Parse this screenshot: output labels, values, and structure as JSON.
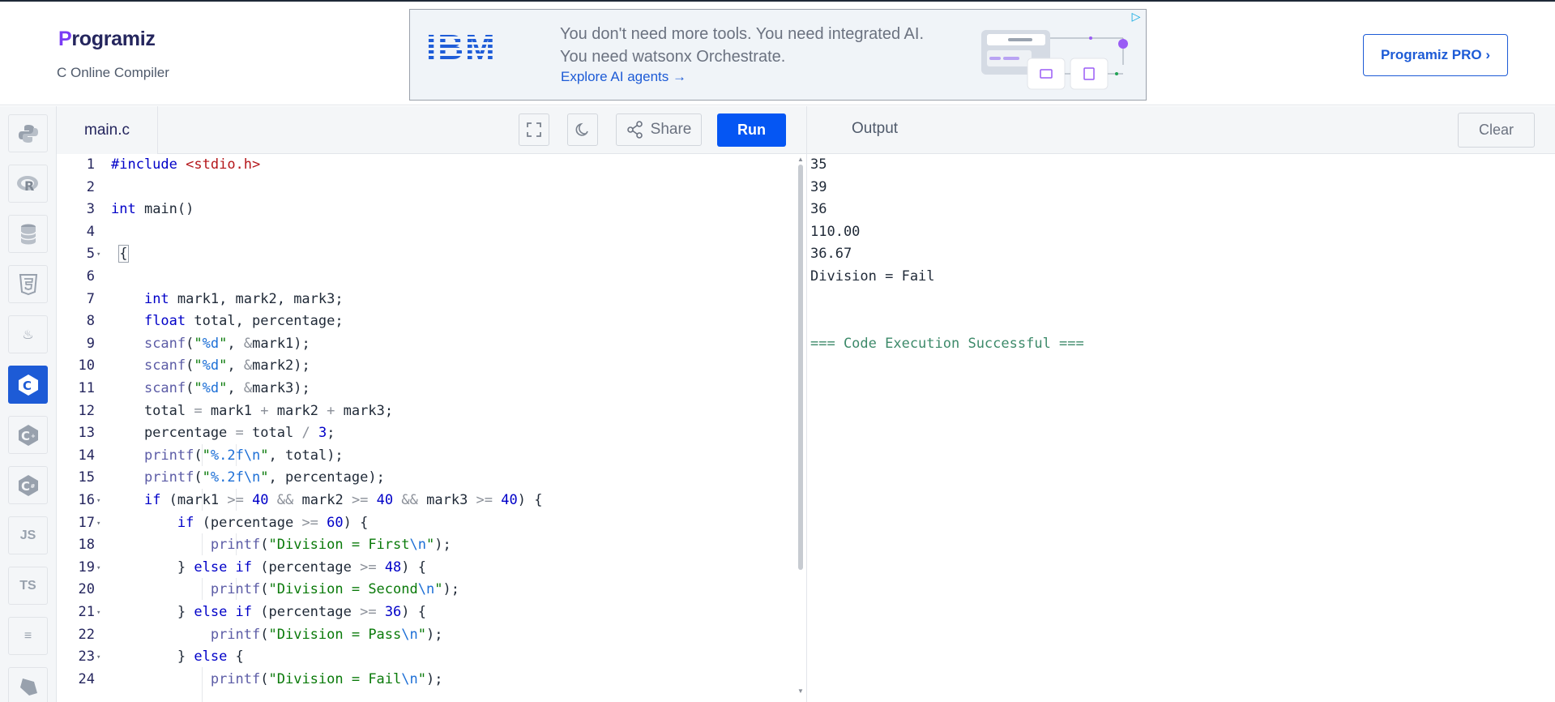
{
  "header": {
    "logo_initial": "P",
    "logo_rest": "rogramiz",
    "subtitle": "C Online Compiler",
    "pro_button": "Programiz PRO ›"
  },
  "ad": {
    "brand": "IBM",
    "text": "You don't need more tools. You need integrated AI. You need watsonx Orchestrate.",
    "link": "Explore AI agents →",
    "badge_icon": "adchoices-icon"
  },
  "rail": {
    "items": [
      {
        "name": "python-icon",
        "glyph": "",
        "active": false
      },
      {
        "name": "r-icon",
        "glyph": "R",
        "active": false
      },
      {
        "name": "sql-database-icon",
        "glyph": "",
        "active": false
      },
      {
        "name": "html5-icon",
        "glyph": "5",
        "active": false
      },
      {
        "name": "java-icon",
        "glyph": "♨",
        "active": false
      },
      {
        "name": "c-icon",
        "glyph": "C",
        "active": true
      },
      {
        "name": "cpp-icon",
        "glyph": "C+",
        "active": false
      },
      {
        "name": "csharp-icon",
        "glyph": "C#",
        "active": false
      },
      {
        "name": "javascript-icon",
        "glyph": "JS",
        "active": false
      },
      {
        "name": "typescript-icon",
        "glyph": "TS",
        "active": false
      },
      {
        "name": "stack-icon",
        "glyph": "≡",
        "active": false
      },
      {
        "name": "dart-icon",
        "glyph": "◆",
        "active": false
      }
    ]
  },
  "editor": {
    "tab_label": "main.c",
    "share_label": "Share",
    "run_label": "Run",
    "line_numbers": [
      "1",
      "2",
      "3",
      "4",
      "5",
      "6",
      "7",
      "8",
      "9",
      "10",
      "11",
      "12",
      "13",
      "14",
      "15",
      "16",
      "17",
      "18",
      "19",
      "20",
      "21",
      "22",
      "23",
      "24"
    ],
    "fold_lines": [
      5,
      16,
      17,
      19,
      21,
      23
    ]
  },
  "output": {
    "title": "Output",
    "clear_label": "Clear",
    "lines": [
      "35",
      "39",
      "36",
      "110.00",
      "36.67",
      "Division = Fail",
      "",
      "",
      "=== Code Execution Successful ==="
    ]
  }
}
